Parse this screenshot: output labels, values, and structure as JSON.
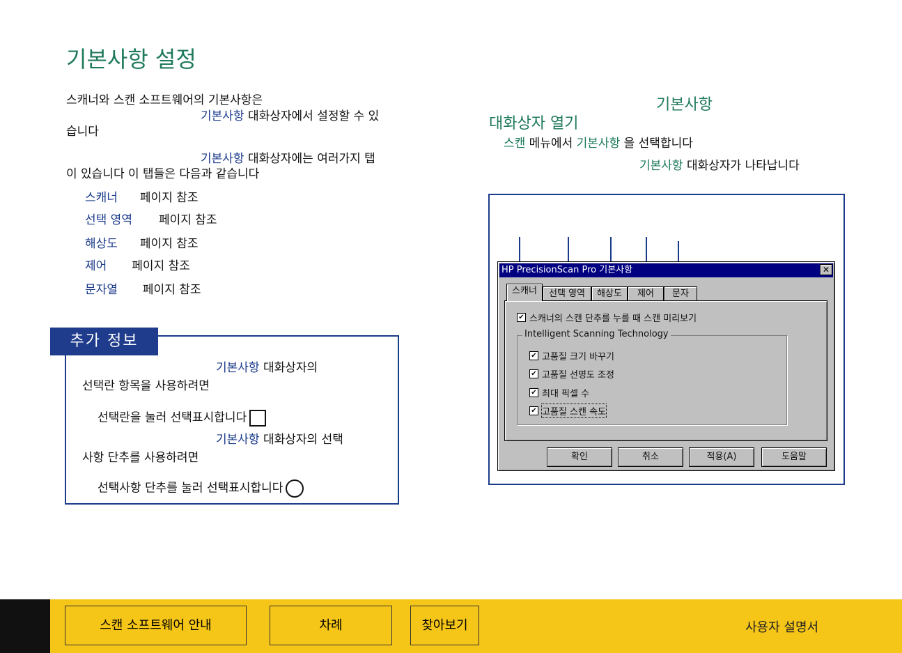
{
  "page": {
    "title": "기본사항 설정",
    "intro": {
      "line1": "스캐너와 스캔 소프트웨어의 기본사항은",
      "line2_link": "기본사항",
      "line2_text": " 대화상자에서 설정할 수 있",
      "line3": "습니다",
      "line4_link": "기본사항",
      "line4_text": " 대화상자에는 여러가지 탭",
      "line5": "이 있습니다  이 탭들은 다음과 같습니다"
    },
    "tab_refs": [
      {
        "link": "스캐너",
        "text": "페이지 참조"
      },
      {
        "link": "선택 영역",
        "text": "페이지 참조"
      },
      {
        "link": "해상도",
        "text": "페이지 참조"
      },
      {
        "link": "제어",
        "text": "페이지 참조"
      },
      {
        "link": "문자열",
        "text": "페이지 참조"
      }
    ]
  },
  "info_box": {
    "tab_label": "추가 정보",
    "p1_link": "기본사항",
    "p1_text": " 대화상자의",
    "p1_line2": "선택란 항목을 사용하려면",
    "p1_line3": "선택란을 눌러 선택표시합니다",
    "p2_link": "기본사항",
    "p2_text": " 대화상자의 선택",
    "p2_line2": "사항 단추를 사용하려면",
    "p2_line3": "선택사항 단추를 눌러 선택표시합니다"
  },
  "right": {
    "heading_top": "기본사항",
    "heading": "대화상자 열기",
    "step1_link1": "스캔",
    "step1_text1": " 메뉴에서 ",
    "step1_link2": "기본사항",
    "step1_text2": "  을 선택합니다",
    "step2_link": "기본사항",
    "step2_text": " 대화상자가 나타납니다"
  },
  "dialog": {
    "title": "HP PrecisionScan Pro 기본사항",
    "close": "✕",
    "tabs": [
      "스캐너",
      "선택 영역",
      "해상도",
      "제어",
      "문자"
    ],
    "preview_check": "스캐너의 스캔 단추를 누를 때 스캔 미리보기",
    "group_title": "Intelligent Scanning Technology",
    "group_checks": [
      "고품질 크기 바꾸기",
      "고품질 선명도 조정",
      "최대 픽셀 수",
      "고품질 스캔 속도"
    ],
    "buttons": [
      "확인",
      "취소",
      "적용(A)",
      "도움말"
    ]
  },
  "footer": {
    "btn1": "스캔 소프트웨어 안내",
    "btn2": "차례",
    "btn3": "찾아보기",
    "right_text": "사용자 설명서"
  }
}
